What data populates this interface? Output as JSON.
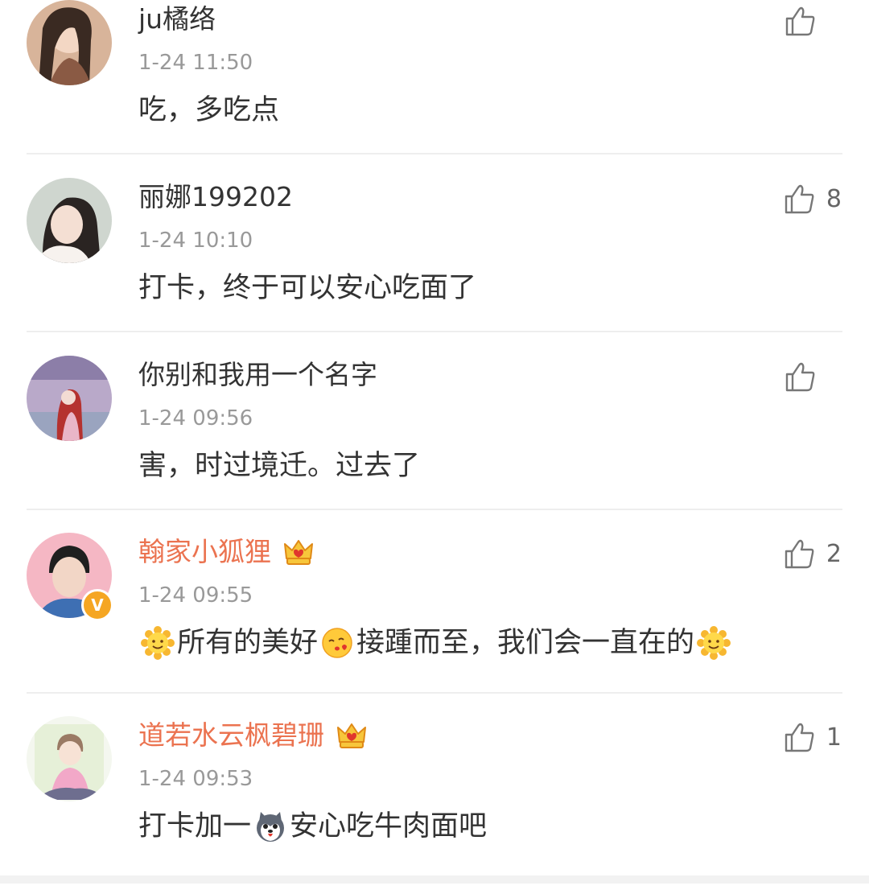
{
  "comments": [
    {
      "username": "ju橘络",
      "time": "1-24 11:50",
      "text": "吃，多吃点",
      "likes": "",
      "vip": false,
      "verified": false
    },
    {
      "username": "丽娜199202",
      "time": "1-24 10:10",
      "text": "打卡，终于可以安心吃面了",
      "likes": "8",
      "vip": false,
      "verified": false
    },
    {
      "username": "你别和我用一个名字",
      "time": "1-24 09:56",
      "text": "害，时过境迁。过去了",
      "likes": "",
      "vip": false,
      "verified": false
    },
    {
      "username": "翰家小狐狸",
      "time": "1-24 09:55",
      "text_parts": [
        "所有的美好",
        "接踵而至，我们会一直在的"
      ],
      "likes": "2",
      "vip": true,
      "verified": true
    },
    {
      "username": "道若水云枫碧珊",
      "time": "1-24 09:53",
      "text_parts": [
        "打卡加一",
        "安心吃牛肉面吧"
      ],
      "likes": "1",
      "vip": true,
      "verified": false
    }
  ],
  "colors": {
    "vip_name": "#eb7350",
    "meta": "#999999",
    "text": "#333333",
    "divider": "#eeeeee",
    "verified_badge": "#f5a623"
  },
  "icons": {
    "like": "thumbs-up-icon",
    "crown": "vip-crown-icon",
    "smile": "sun-smile-emoji",
    "kiss": "kiss-face-emoji",
    "husky": "husky-emoji"
  }
}
